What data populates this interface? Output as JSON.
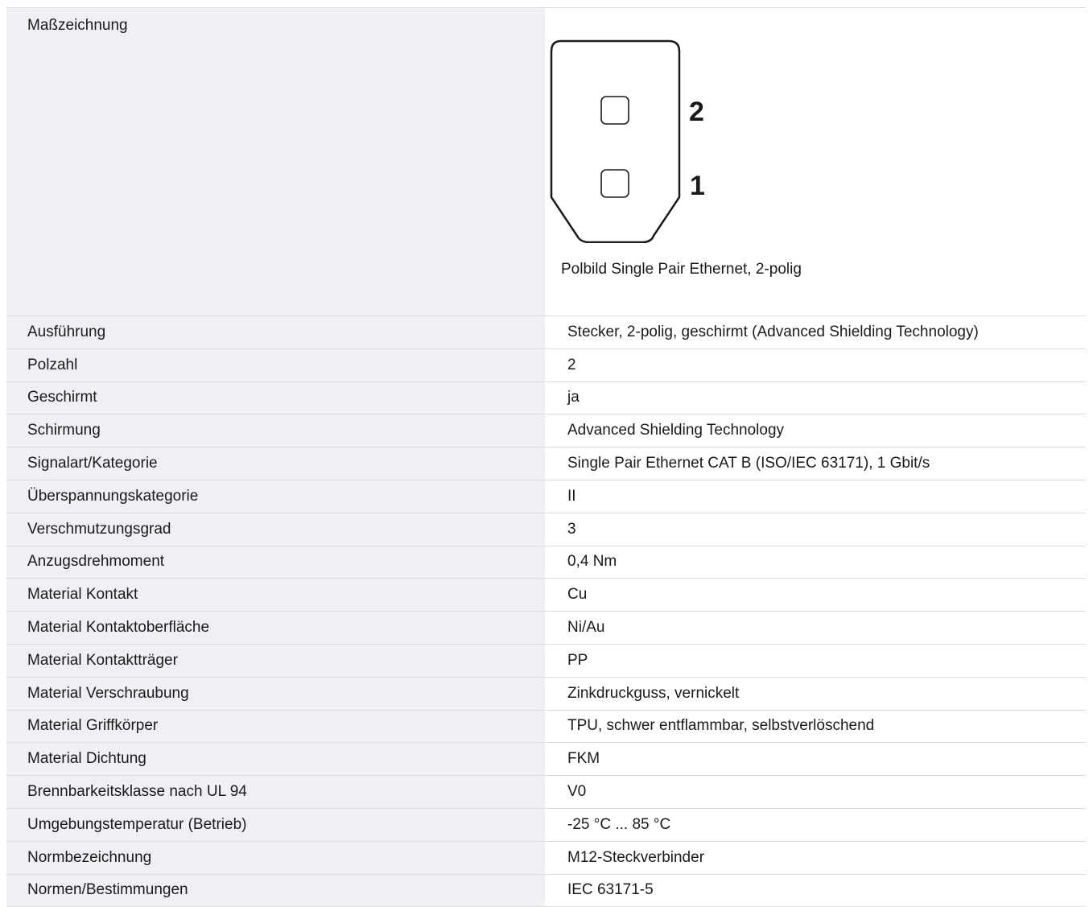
{
  "drawing": {
    "label": "Maßzeichnung",
    "pin_top": "2",
    "pin_bottom": "1",
    "caption": "Polbild Single Pair Ethernet, 2-polig"
  },
  "rows": [
    {
      "label": "Ausführung",
      "value": "Stecker, 2-polig, geschirmt (Advanced Shielding Technology)"
    },
    {
      "label": "Polzahl",
      "value": "2"
    },
    {
      "label": "Geschirmt",
      "value": "ja"
    },
    {
      "label": "Schirmung",
      "value": "Advanced Shielding Technology"
    },
    {
      "label": "Signalart/Kategorie",
      "value": "Single Pair Ethernet CAT B (ISO/IEC 63171), 1 Gbit/s"
    },
    {
      "label": "Überspannungskategorie",
      "value": "II"
    },
    {
      "label": "Verschmutzungsgrad",
      "value": "3"
    },
    {
      "label": "Anzugsdrehmoment",
      "value": "0,4 Nm"
    },
    {
      "label": "Material Kontakt",
      "value": "Cu"
    },
    {
      "label": "Material Kontaktoberfläche",
      "value": "Ni/Au"
    },
    {
      "label": "Material Kontaktträger",
      "value": "PP"
    },
    {
      "label": "Material Verschraubung",
      "value": "Zinkdruckguss, vernickelt"
    },
    {
      "label": "Material Griffkörper",
      "value": "TPU, schwer entflammbar, selbstverlöschend"
    },
    {
      "label": "Material Dichtung",
      "value": "FKM"
    },
    {
      "label": "Brennbarkeitsklasse nach UL 94",
      "value": "V0"
    },
    {
      "label": "Umgebungstemperatur (Betrieb)",
      "value": "-25 °C ... 85 °C"
    },
    {
      "label": "Normbezeichnung",
      "value": "M12-Steckverbinder"
    },
    {
      "label": "Normen/Bestimmungen",
      "value": "IEC 63171-5"
    }
  ]
}
